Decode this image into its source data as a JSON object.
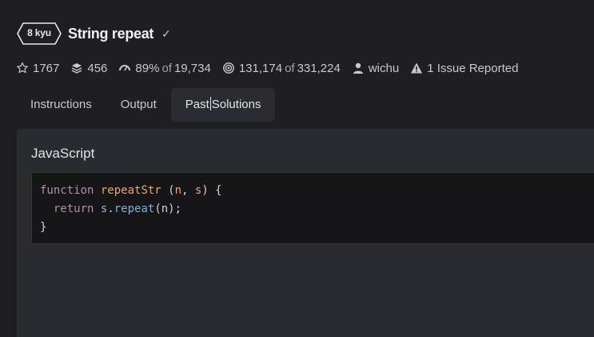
{
  "kata": {
    "rank": "8 kyu",
    "title": "String repeat",
    "completed_mark": "✓"
  },
  "stats": {
    "stars": "1767",
    "collections": "456",
    "satisfaction_pct": "89%",
    "satisfaction_of": "of",
    "satisfaction_votes": "19,734",
    "completed": "131,174",
    "completed_of": "of",
    "attempted": "331,224",
    "author": "wichu",
    "issues": "1 Issue Reported"
  },
  "tabs": [
    {
      "label": "Instructions"
    },
    {
      "label": "Output"
    },
    {
      "label_before_caret": "Past",
      "label_after_caret": "Solutions"
    }
  ],
  "solution": {
    "language": "JavaScript",
    "code": {
      "l1_kw": "function",
      "l1_fn": "repeatStr",
      "l1_open": " (",
      "l1_p1": "n",
      "l1_comma": ", ",
      "l1_p2": "s",
      "l1_close": ") {",
      "l2_kw": "return",
      "l2_obj": "s",
      "l2_dot": ".",
      "l2_method": "repeat",
      "l2_args": "(n);",
      "l3": "}"
    }
  },
  "colors": {
    "background": "#1f1f21",
    "panel": "#2a2b2f",
    "code_bg": "#161618",
    "keyword": "#c586c0",
    "function": "#e6a96b"
  }
}
